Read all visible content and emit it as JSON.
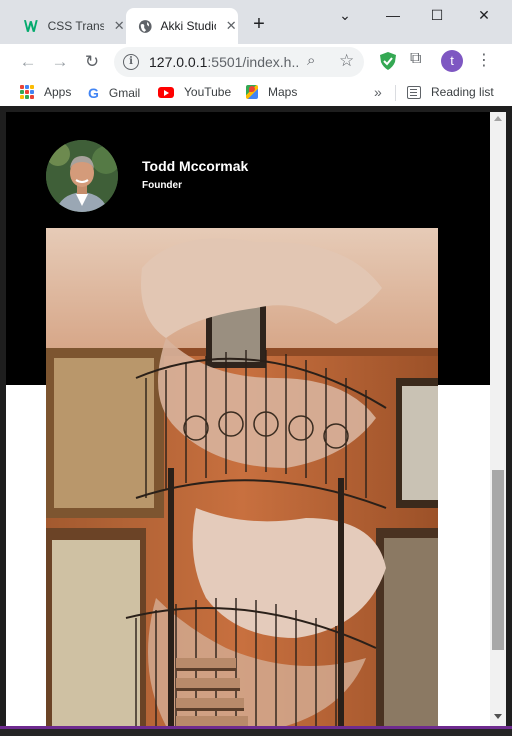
{
  "browser": {
    "tabs": [
      {
        "title": "CSS Transitions",
        "active": false
      },
      {
        "title": "Akki Studio",
        "active": true
      }
    ],
    "url_host": "127.0.0.1",
    "url_rest": ":5501/index.h...",
    "profile_initial": "t",
    "bookmarks": [
      {
        "label": "Apps",
        "icon": "apps-grid-icon"
      },
      {
        "label": "Gmail",
        "icon": "google-icon"
      },
      {
        "label": "YouTube",
        "icon": "youtube-icon"
      },
      {
        "label": "Maps",
        "icon": "maps-icon"
      }
    ],
    "reading_list_label": "Reading list"
  },
  "page": {
    "profile": {
      "name": "Todd Mccormak",
      "role": "Founder"
    }
  },
  "colors": {
    "hero_background": "#000000",
    "chrome_frame": "#dee1e6",
    "avatar_purple": "#7e57c2"
  }
}
